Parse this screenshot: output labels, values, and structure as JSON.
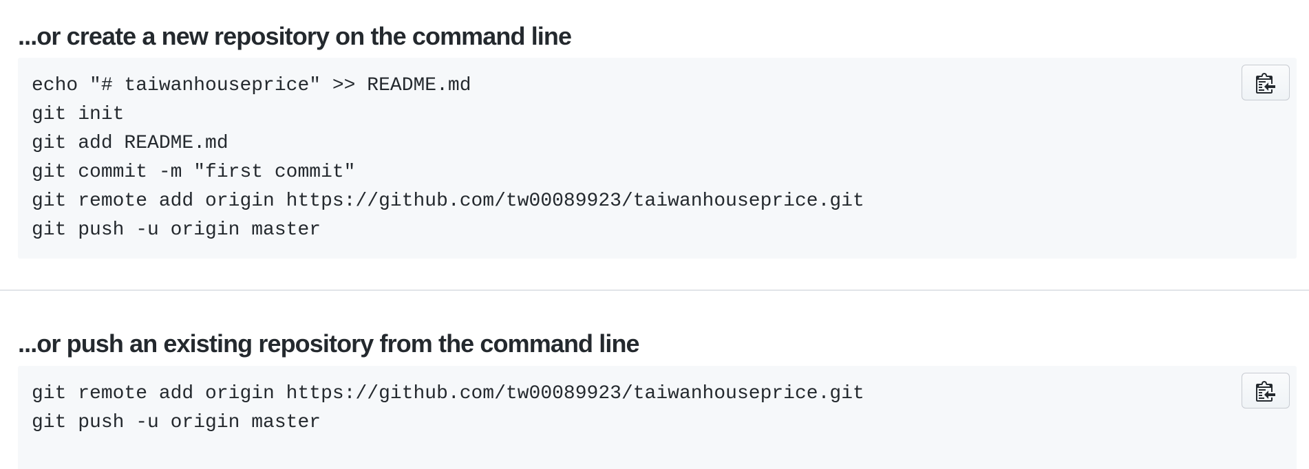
{
  "sections": [
    {
      "heading": "...or create a new repository on the command line",
      "lines": [
        "echo \"# taiwanhouseprice\" >> README.md",
        "git init",
        "git add README.md",
        "git commit -m \"first commit\"",
        "git remote add origin https://github.com/tw00089923/taiwanhouseprice.git",
        "git push -u origin master"
      ],
      "copy_icon": "clippy-icon"
    },
    {
      "heading": "...or push an existing repository from the command line",
      "lines": [
        "git remote add origin https://github.com/tw00089923/taiwanhouseprice.git",
        "git push -u origin master"
      ],
      "copy_icon": "clippy-icon"
    }
  ],
  "colors": {
    "text": "#24292e",
    "code_background": "#f6f8fa",
    "divider": "#e1e4e8",
    "button_border": "#c7cbd1"
  }
}
